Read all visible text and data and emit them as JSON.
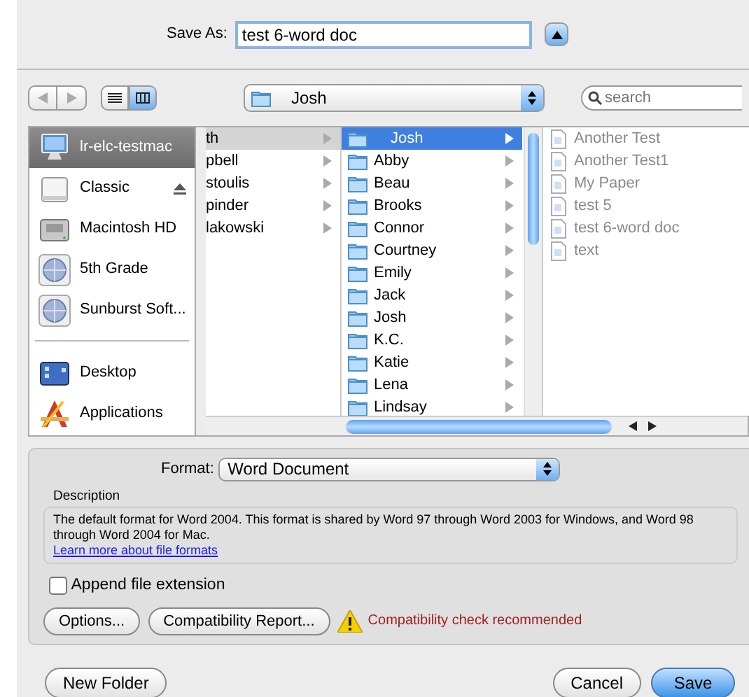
{
  "save_as": {
    "label": "Save As:",
    "value": "test 6-word doc",
    "expanded": true
  },
  "toolbar": {
    "view_modes": [
      {
        "kind": "list",
        "selected": false
      },
      {
        "kind": "columns",
        "selected": true
      }
    ],
    "location": "Josh",
    "search": {
      "placeholder": "search"
    }
  },
  "sidebar": {
    "sections": [
      {
        "items": [
          {
            "kind": "computer",
            "label": "lr-elc-testmac",
            "selected": true,
            "eject": false
          },
          {
            "kind": "disk",
            "label": "Classic",
            "selected": false,
            "eject": true
          },
          {
            "kind": "harddisk",
            "label": "Macintosh HD",
            "selected": false,
            "eject": false
          },
          {
            "kind": "network",
            "label": "5th Grade",
            "selected": false,
            "eject": false
          },
          {
            "kind": "network",
            "label": "Sunburst Soft...",
            "selected": false,
            "eject": false
          }
        ]
      },
      {
        "items": [
          {
            "kind": "desktop",
            "label": "Desktop",
            "selected": false,
            "eject": false
          },
          {
            "kind": "applications",
            "label": "Applications",
            "selected": false,
            "eject": false
          }
        ]
      }
    ]
  },
  "columns": [
    {
      "items": [
        {
          "kind": "plain",
          "label": "th",
          "selected": true,
          "disabled": false
        },
        {
          "kind": "plain",
          "label": "pbell",
          "selected": false,
          "disabled": false
        },
        {
          "kind": "plain",
          "label": "stoulis",
          "selected": false,
          "disabled": false
        },
        {
          "kind": "plain",
          "label": "pinder",
          "selected": false,
          "disabled": false
        },
        {
          "kind": "plain",
          "label": "lakowski",
          "selected": false,
          "disabled": false
        }
      ]
    },
    {
      "items": [
        {
          "kind": "folder",
          "label": "Josh",
          "selected": true,
          "disabled": false
        },
        {
          "kind": "folder",
          "label": "Abby",
          "selected": false,
          "disabled": false
        },
        {
          "kind": "folder",
          "label": "Beau",
          "selected": false,
          "disabled": false
        },
        {
          "kind": "folder",
          "label": "Brooks",
          "selected": false,
          "disabled": false
        },
        {
          "kind": "folder",
          "label": "Connor",
          "selected": false,
          "disabled": false
        },
        {
          "kind": "folder",
          "label": "Courtney",
          "selected": false,
          "disabled": false
        },
        {
          "kind": "folder",
          "label": "Emily",
          "selected": false,
          "disabled": false
        },
        {
          "kind": "folder",
          "label": "Jack",
          "selected": false,
          "disabled": false
        },
        {
          "kind": "folder",
          "label": "Josh",
          "selected": false,
          "disabled": false
        },
        {
          "kind": "folder",
          "label": "K.C.",
          "selected": false,
          "disabled": false
        },
        {
          "kind": "folder",
          "label": "Katie",
          "selected": false,
          "disabled": false
        },
        {
          "kind": "folder",
          "label": "Lena",
          "selected": false,
          "disabled": false
        },
        {
          "kind": "folder",
          "label": "Lindsay",
          "selected": false,
          "disabled": false
        }
      ]
    },
    {
      "items": [
        {
          "kind": "file",
          "label": "Another Test",
          "selected": false,
          "disabled": true
        },
        {
          "kind": "file",
          "label": "Another Test1",
          "selected": false,
          "disabled": true
        },
        {
          "kind": "file",
          "label": "My Paper",
          "selected": false,
          "disabled": true
        },
        {
          "kind": "file",
          "label": "test 5",
          "selected": false,
          "disabled": true
        },
        {
          "kind": "file",
          "label": "test 6-word doc",
          "selected": false,
          "disabled": true
        },
        {
          "kind": "file",
          "label": "text",
          "selected": false,
          "disabled": true
        }
      ]
    }
  ],
  "options_panel": {
    "format": {
      "label": "Format:",
      "value": "Word Document"
    },
    "description": {
      "label": "Description",
      "text": "The default format for Word 2004. This format is shared by Word 97 through Word 2003 for Windows, and Word 98 through Word 2004 for Mac.",
      "link": "Learn more about file formats"
    },
    "append_extension": {
      "label": "Append file extension",
      "checked": false
    },
    "buttons": [
      "Options...",
      "Compatibility Report..."
    ],
    "warning": "Compatibility check recommended"
  },
  "buttons": [
    {
      "kind": "secondary",
      "label": "New Folder"
    },
    {
      "kind": "secondary",
      "label": "Cancel"
    },
    {
      "kind": "default",
      "label": "Save"
    }
  ]
}
